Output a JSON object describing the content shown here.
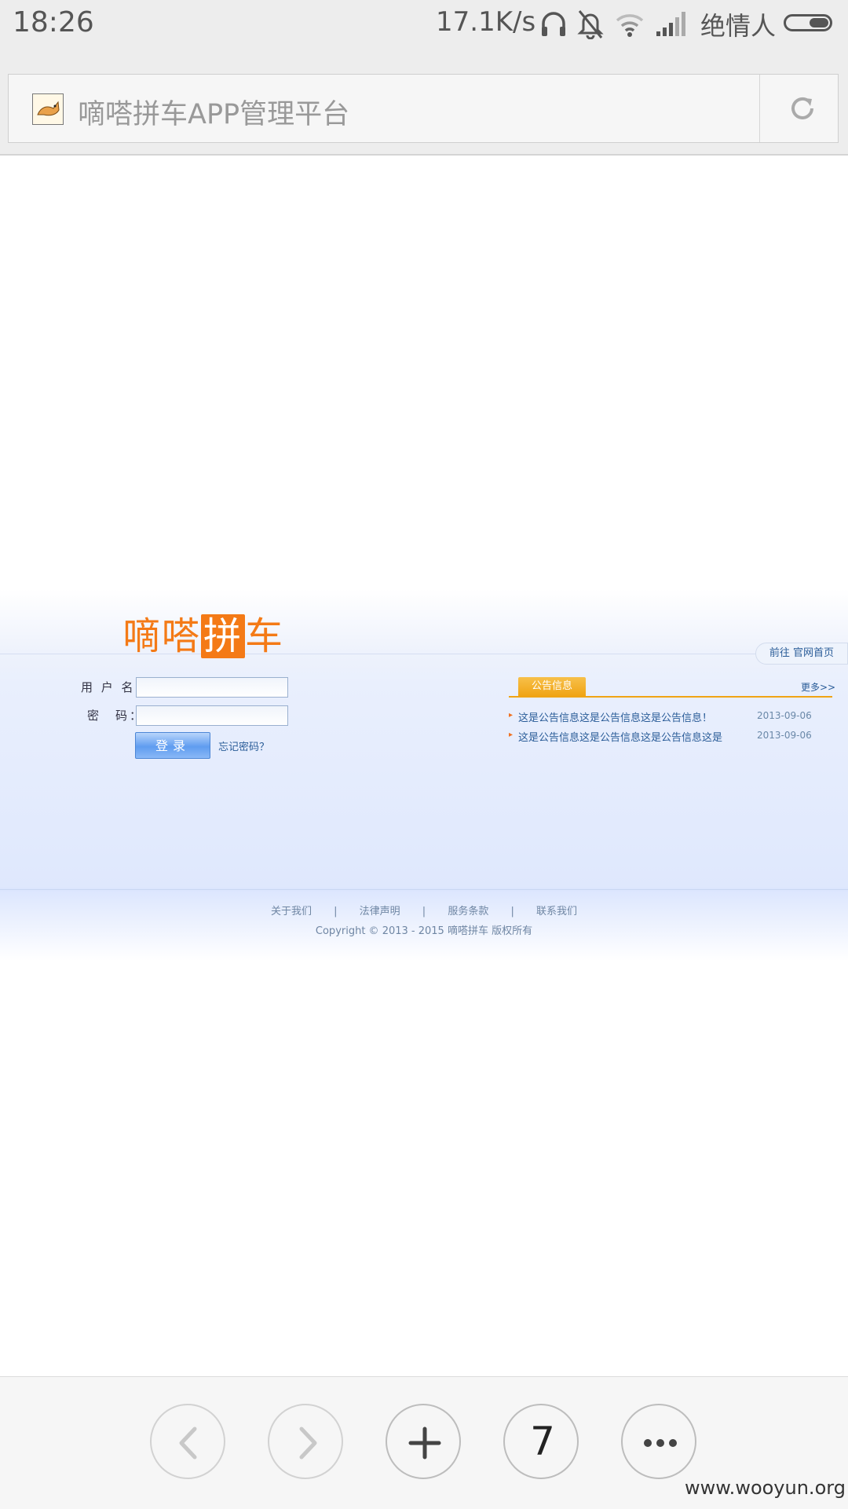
{
  "status_bar": {
    "time": "18:26",
    "speed": "17.1K/s",
    "carrier": "绝情人",
    "icons": [
      "headphones-icon",
      "bell-muted-icon",
      "wifi-icon",
      "signal-icon",
      "battery-icon"
    ]
  },
  "browser": {
    "page_title": "嘀嗒拼车APP管理平台",
    "favicon": "tomcat-favicon",
    "reload_icon": "reload-icon"
  },
  "site": {
    "logo": {
      "pre": "嘀嗒",
      "highlight": "拼",
      "post": "车"
    },
    "home_link": "前往 官网首页",
    "login": {
      "username_label": "用 户 名：",
      "password_label": "密　码：",
      "username_value": "",
      "password_value": "",
      "submit_label": "登录",
      "forgot_label": "忘记密码？"
    },
    "notices": {
      "tab_label": "公告信息",
      "more_label": "更多>>",
      "items": [
        {
          "text": "这是公告信息这是公告信息这是公告信息！",
          "date": "2013-09-06"
        },
        {
          "text": "这是公告信息这是公告信息这是公告信息这是",
          "date": "2013-09-06"
        }
      ]
    },
    "footer": {
      "links": [
        "关于我们",
        "|",
        "法律声明",
        "|",
        "服务条款",
        "|",
        "联系我们"
      ],
      "copyright": "Copyright © 2013 - 2015 嘀嗒拼车 版权所有"
    }
  },
  "bottom_nav": {
    "tab_count": "7",
    "buttons": [
      "back-icon",
      "forward-icon",
      "new-tab-icon",
      "tabs-counter",
      "more-icon"
    ]
  },
  "watermark": "www.wooyun.org",
  "colors": {
    "brand_orange": "#f47a16",
    "link_blue": "#2a5c98",
    "notice_gold": "#f0a414"
  }
}
